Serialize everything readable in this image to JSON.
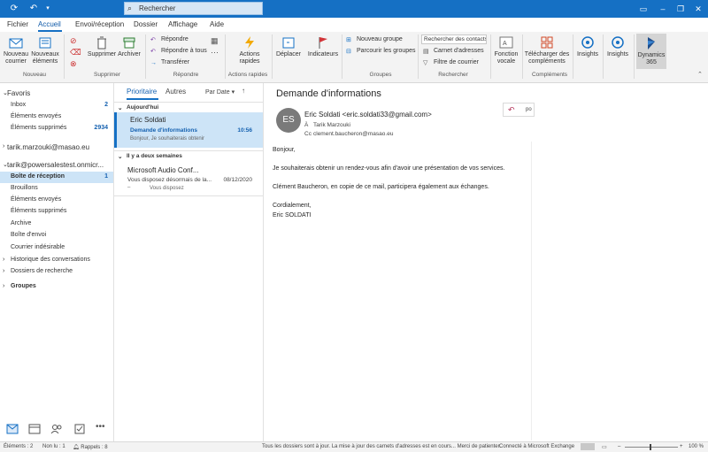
{
  "titlebar": {
    "search_placeholder": "Rechercher",
    "colors": {
      "accent": "#1570c4"
    }
  },
  "menu": {
    "tabs": [
      "Fichier",
      "Accueil",
      "Envoi/réception",
      "Dossier",
      "Affichage",
      "Aide"
    ],
    "active": "Accueil"
  },
  "ribbon": {
    "nouveau_courrier": "Nouveau courrier",
    "nouveaux_elements": "Nouveaux éléments",
    "supprimer": "Supprimer",
    "archiver": "Archiver",
    "repondre": "Répondre",
    "repondre_tous": "Répondre à tous",
    "transferer": "Transférer",
    "actions_rapides": "Actions rapides",
    "deplacer": "Déplacer",
    "indicateurs": "Indicateurs",
    "nouveau_groupe": "Nouveau groupe",
    "parcourir_groupes": "Parcourir les groupes",
    "rechercher_contacts": "Rechercher des contacts",
    "carnet_adresses": "Carnet d'adresses",
    "filtre_courrier": "Filtre de courrier",
    "fonction_vocale": "Fonction vocale",
    "telecharger_complements": "Télécharger des compléments",
    "insights1": "Insights",
    "insights2": "Insights",
    "dynamics": "Dynamics 365",
    "groups": {
      "nouveau": "Nouveau",
      "supprimer": "Supprimer",
      "repondre": "Répondre",
      "actions_rapides": "Actions rapides",
      "groupes": "Groupes",
      "rechercher": "Rechercher",
      "complements": "Compléments"
    }
  },
  "folders": {
    "favoris": "Favoris",
    "fav_items": [
      {
        "label": "Inbox",
        "count": "2"
      },
      {
        "label": "Éléments envoyés",
        "count": ""
      },
      {
        "label": "Éléments supprimés",
        "count": "2934"
      }
    ],
    "account1": "tarik.marzouki@masao.eu",
    "account2": "tarik@powersalestest.onmicr...",
    "items": [
      {
        "label": "Boîte de réception",
        "count": "1"
      },
      {
        "label": "Brouillons",
        "count": ""
      },
      {
        "label": "Éléments envoyés",
        "count": ""
      },
      {
        "label": "Éléments supprimés",
        "count": ""
      },
      {
        "label": "Archive",
        "count": ""
      },
      {
        "label": "Boîte d'envoi",
        "count": ""
      },
      {
        "label": "Courrier indésirable",
        "count": ""
      },
      {
        "label": "Historique des conversations",
        "count": ""
      },
      {
        "label": "Dossiers de recherche",
        "count": ""
      }
    ],
    "groupes": "Groupes"
  },
  "list": {
    "tab_prioritaire": "Prioritaire",
    "tab_autres": "Autres",
    "sort": "Par Date",
    "group1": "Aujourd'hui",
    "group2": "Il y a deux semaines",
    "messages": [
      {
        "from": "Eric Soldati",
        "subject": "Demande d'informations",
        "preview": "Bonjour,  Je souhaiterais obtenir",
        "time": "10:56"
      },
      {
        "from": "Microsoft Audio Conf...",
        "subject": "Vous disposez désormais de la...",
        "preview": "Vous disposez",
        "time": "08/12/2020"
      }
    ]
  },
  "reading": {
    "subject": "Demande d'informations",
    "avatar": "ES",
    "from": "Eric Soldati <eric.soldati33@gmail.com>",
    "to_label": "À",
    "to": "Tarik Marzouki",
    "cc_label": "Cc",
    "cc": "clement.baucheron@masao.eu",
    "reply_tooltip": "po",
    "body": [
      "Bonjour,",
      "Je souhaiterais obtenir un rendez-vous afin d'avoir une présentation de vos services.",
      "Clément Baucheron, en copie de ce mail, participera également aux échanges.",
      "Cordialement,",
      "Eric SOLDATI"
    ]
  },
  "status": {
    "elements": "Éléments : 2",
    "non_lu": "Non lu : 1",
    "rappels": "Rappels : 8",
    "sync": "Tous les dossiers sont à jour.  La mise à jour des carnets d'adresses est en cours... Merci de patienter.",
    "connection": "Connecté à Microsoft Exchange",
    "zoom": "100 %"
  }
}
